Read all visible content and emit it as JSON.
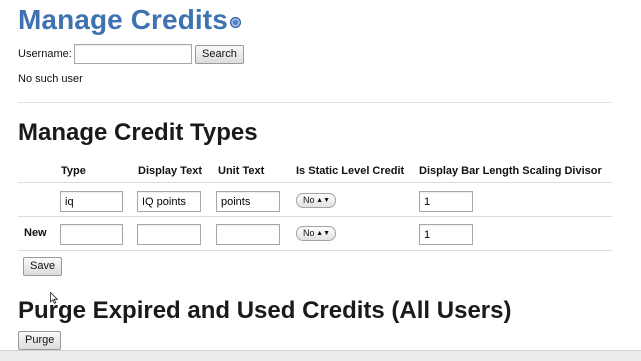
{
  "page": {
    "title": "Manage Credits",
    "help_icon": "help-icon"
  },
  "search": {
    "username_label": "Username:",
    "username_value": "",
    "username_placeholder": "",
    "search_label": "Search",
    "message": "No such user"
  },
  "credit_types": {
    "heading": "Manage Credit Types",
    "columns": [
      "Type",
      "Display Text",
      "Unit Text",
      "Is Static Level Credit",
      "Display Bar Length Scaling Divisor"
    ],
    "rows": [
      {
        "row_label": "",
        "type": "iq",
        "display_text": "IQ points",
        "unit_text": "points",
        "static": "No",
        "divisor": "1"
      },
      {
        "row_label": "New",
        "type": "",
        "display_text": "",
        "unit_text": "",
        "static": "No",
        "divisor": "1"
      }
    ],
    "save_label": "Save"
  },
  "purge": {
    "heading": "Purge Expired and Used Credits (All Users)",
    "button_label": "Purge"
  }
}
